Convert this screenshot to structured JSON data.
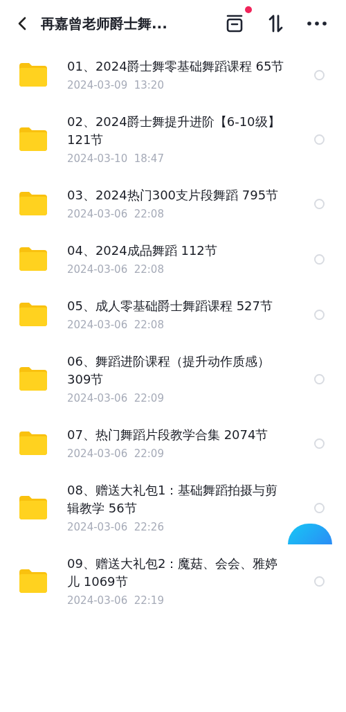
{
  "header": {
    "title": "再嘉曾老师爵士舞...",
    "notification": true
  },
  "items": [
    {
      "name": "01、2024爵士舞零基础舞蹈课程  65节",
      "date": "2024-03-09  13:20",
      "selected": false
    },
    {
      "name": "02、2024爵士舞提升进阶【6-10级】121节",
      "date": "2024-03-10  18:47",
      "selected": false
    },
    {
      "name": "03、2024热门300支片段舞蹈  795节",
      "date": "2024-03-06  22:08",
      "selected": false
    },
    {
      "name": "04、2024成品舞蹈  112节",
      "date": "2024-03-06  22:08",
      "selected": false
    },
    {
      "name": "05、成人零基础爵士舞蹈课程  527节",
      "date": "2024-03-06  22:08",
      "selected": false
    },
    {
      "name": "06、舞蹈进阶课程（提升动作质感）309节",
      "date": "2024-03-06  22:09",
      "selected": false
    },
    {
      "name": "07、热门舞蹈片段教学合集  2074节",
      "date": "2024-03-06  22:09",
      "selected": false
    },
    {
      "name": "08、赠送大礼包1：基础舞蹈拍摄与剪辑教学 56节",
      "date": "2024-03-06  22:26",
      "selected": false
    },
    {
      "name": "09、赠送大礼包2：魔菇、会会、雅婷儿 1069节",
      "date": "2024-03-06  22:19",
      "selected": false
    }
  ]
}
